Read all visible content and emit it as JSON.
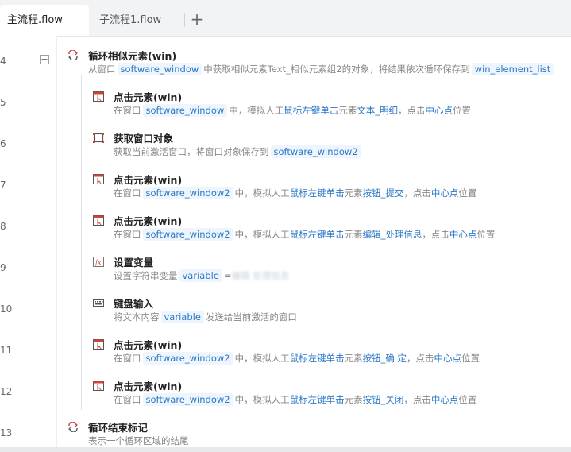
{
  "tabs": {
    "main_label": "主流程.flow",
    "sub_label": "子流程1.flow",
    "add_symbol": "+"
  },
  "line_numbers": [
    "4",
    "5",
    "6",
    "7",
    "8",
    "9",
    "10",
    "11",
    "12",
    "13"
  ],
  "fold_symbol": "−",
  "steps": [
    {
      "title": "循环相似元素(win)",
      "icon": "loop-icon",
      "desc": [
        "从窗口",
        "software_window",
        "中获取相似元素Text_相似元素组2的对象，将结果依次循环保存到",
        "win_element_list"
      ]
    },
    {
      "title": "点击元素(win)",
      "icon": "click-element-icon",
      "desc": [
        "在窗口",
        "software_window",
        "中，模拟人工",
        "鼠标左键单击",
        "元素",
        "文本_明细",
        "，点击",
        "中心点",
        "位置"
      ]
    },
    {
      "title": "获取窗口对象",
      "icon": "window-capture-icon",
      "desc": [
        "获取当前激活窗口，将窗口对象保存到",
        "software_window2"
      ]
    },
    {
      "title": "点击元素(win)",
      "icon": "click-element-icon",
      "desc": [
        "在窗口",
        "software_window2",
        "中，模拟人工",
        "鼠标左键单击",
        "元素",
        "按钮_提交",
        "，点击",
        "中心点",
        "位置"
      ]
    },
    {
      "title": "点击元素(win)",
      "icon": "click-element-icon",
      "desc": [
        "在窗口",
        "software_window2",
        "中，模拟人工",
        "鼠标左键单击",
        "元素",
        "编辑_处理信息",
        "，点击",
        "中心点",
        "位置"
      ]
    },
    {
      "title": "设置变量",
      "icon": "variable-fx-icon",
      "desc": [
        "设置字符串变量",
        "variable",
        "=",
        "编辑 处理信息"
      ]
    },
    {
      "title": "键盘输入",
      "icon": "keyboard-icon",
      "desc": [
        "将文本内容",
        "variable",
        "发送给当前激活的窗口"
      ]
    },
    {
      "title": "点击元素(win)",
      "icon": "click-element-icon",
      "desc": [
        "在窗口",
        "software_window2",
        "中，模拟人工",
        "鼠标左键单击",
        "元素",
        "按钮_确 定",
        "，点击",
        "中心点",
        "位置"
      ]
    },
    {
      "title": "点击元素(win)",
      "icon": "click-element-icon",
      "desc": [
        "在窗口",
        "software_window2",
        "中，模拟人工",
        "鼠标左键单击",
        "元素",
        "按钮_关闭",
        "，点击",
        "中心点",
        "位置"
      ]
    },
    {
      "title": "循环结束标记",
      "icon": "loop-end-icon",
      "desc": [
        "表示一个循环区域的结尾"
      ]
    }
  ],
  "colors": {
    "accent": "#2b78c7",
    "chip_bg": "#eef5fd",
    "icon_red": "#c8453b"
  }
}
